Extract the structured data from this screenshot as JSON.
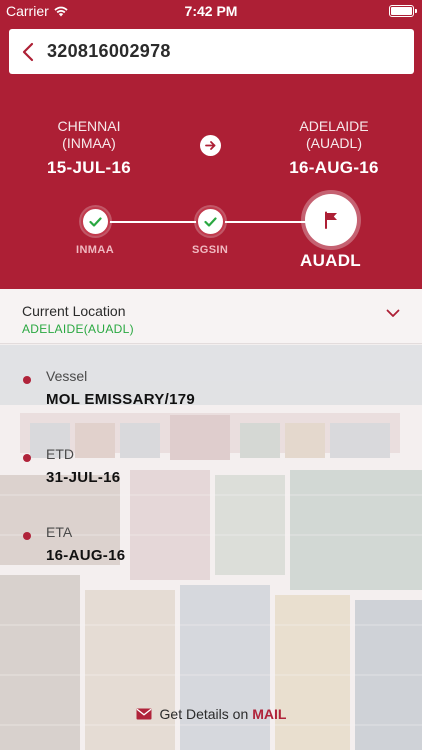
{
  "status_bar": {
    "carrier": "Carrier",
    "time": "7:42 PM"
  },
  "search": {
    "value": "320816002978"
  },
  "route": {
    "origin": {
      "city": "CHENNAI",
      "code": "(INMAA)",
      "date": "15-JUL-16"
    },
    "destination": {
      "city": "ADELAIDE",
      "code": "(AUADL)",
      "date": "16-AUG-16"
    }
  },
  "progress": {
    "stops": [
      {
        "label": "INMAA"
      },
      {
        "label": "SGSIN"
      },
      {
        "label": "AUADL"
      }
    ]
  },
  "current_location": {
    "title": "Current Location",
    "value": "ADELAIDE(AUADL)"
  },
  "details": [
    {
      "label": "Vessel",
      "value": "MOL EMISSARY/179"
    },
    {
      "label": "ETD",
      "value": "31-JUL-16"
    },
    {
      "label": "ETA",
      "value": "16-AUG-16"
    }
  ],
  "footer": {
    "text": "Get Details on",
    "link": "MAIL"
  },
  "colors": {
    "brand": "#ad1f35",
    "success": "#2aa841"
  }
}
